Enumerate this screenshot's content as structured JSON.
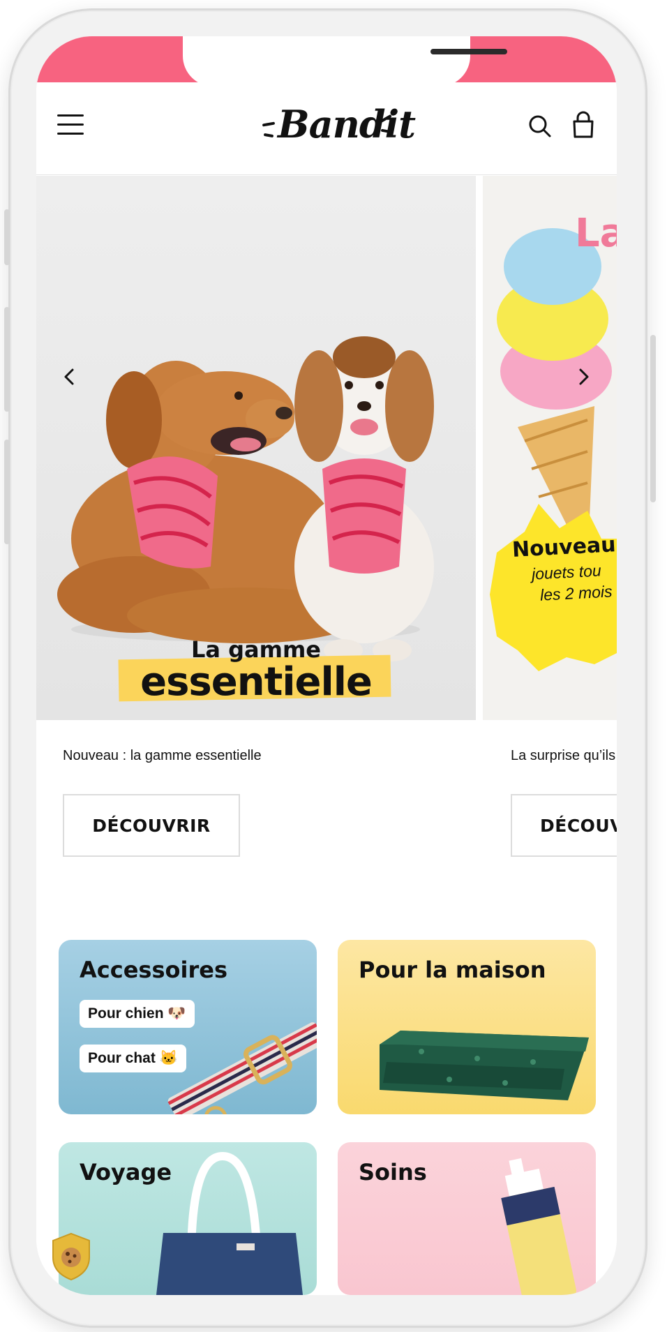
{
  "header": {
    "logo_text": "Bandit",
    "menu_icon": "hamburger-menu-icon",
    "search_icon": "search-icon",
    "cart_icon": "shopping-bag-icon"
  },
  "hero": {
    "slides": [
      {
        "headline_top": "La gamme",
        "headline_bottom": "essentielle",
        "caption": "Nouveau : la gamme essentielle",
        "cta_label": "DÉCOUVRIR"
      },
      {
        "headline_top": "La",
        "badge_title": "Nouveau",
        "badge_line1": "jouets tou",
        "badge_line2": "les 2 mois",
        "caption": "La surprise qu’ils",
        "cta_label": "DÉCOUV"
      }
    ]
  },
  "categories": [
    {
      "title": "Accessoires",
      "links": [
        "Pour chien 🐶",
        "Pour chat 🐱"
      ],
      "color_top": "#a6d0e4",
      "color_bottom": "#7fb8d1"
    },
    {
      "title": "Pour la maison",
      "color_top": "#fde7a3",
      "color_bottom": "#f9d96e"
    },
    {
      "title": "Voyage",
      "color_top": "#bfe7e3",
      "color_bottom": "#a9dcd6"
    },
    {
      "title": "Soins",
      "color_top": "#fbd3da",
      "color_bottom": "#f9c6d0"
    }
  ],
  "colors": {
    "status_bar": "#f76380",
    "badge_yellow": "#fde52a",
    "highlight_yellow": "#fbd45a"
  },
  "cookie_icon": "cookie-shield-icon"
}
